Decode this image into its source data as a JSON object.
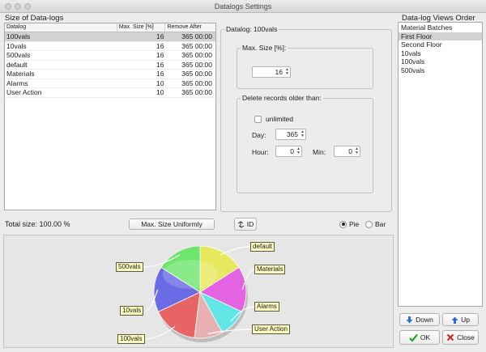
{
  "window": {
    "title": "Datalogs Settings"
  },
  "left_section": {
    "title": "Size of Data-logs",
    "columns": [
      "Datalog",
      "Max. Size [%]",
      "Remove After"
    ],
    "rows": [
      {
        "name": "100vals",
        "size": "16",
        "remove": "365 00:00",
        "selected": true
      },
      {
        "name": "10vals",
        "size": "16",
        "remove": "365 00:00"
      },
      {
        "name": "500vals",
        "size": "16",
        "remove": "365 00:00"
      },
      {
        "name": "default",
        "size": "16",
        "remove": "365 00:00"
      },
      {
        "name": "Materials",
        "size": "16",
        "remove": "365 00:00"
      },
      {
        "name": "Alarms",
        "size": "10",
        "remove": "365 00:00"
      },
      {
        "name": "User Action",
        "size": "10",
        "remove": "365 00:00"
      }
    ],
    "total_label": "Total size: 100.00 %",
    "uniform_button": "Max. Size Uniformly",
    "id_button": "ID",
    "radio_pie": "Pie",
    "radio_bar": "Bar",
    "chart_mode": "Pie"
  },
  "detail": {
    "title": "Datalog: 100vals",
    "max_size": {
      "label": "Max. Size [%]:",
      "value": "16"
    },
    "delete": {
      "label": "Delete records older than:",
      "unlimited_label": "unlimited",
      "unlimited_checked": false,
      "day_label": "Day:",
      "day_value": "365",
      "hour_label": "Hour:",
      "hour_value": "0",
      "min_label": "Min:",
      "min_value": "0"
    }
  },
  "chart_data": {
    "type": "pie",
    "labels": [
      "default",
      "Materials",
      "Alarms",
      "User Action",
      "100vals",
      "10vals",
      "500vals"
    ],
    "values": [
      16,
      16,
      10,
      10,
      16,
      16,
      16
    ],
    "colors": [
      "#e8e85e",
      "#e363e3",
      "#63e5e5",
      "#e8b0b0",
      "#e86464",
      "#6b6be6",
      "#6ee66e"
    ]
  },
  "right_section": {
    "title": "Data-log Views Order",
    "items": [
      {
        "label": "Material Batches"
      },
      {
        "label": "First Floor",
        "selected": true
      },
      {
        "label": "Second Floor"
      },
      {
        "label": "10vals"
      },
      {
        "label": "100vals"
      },
      {
        "label": "500vals"
      }
    ],
    "down_button": "Down",
    "up_button": "Up",
    "ok_button": "OK",
    "close_button": "Close"
  }
}
